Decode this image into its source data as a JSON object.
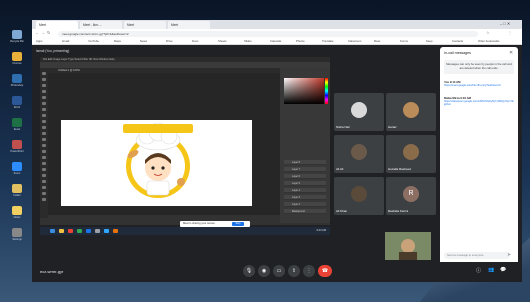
{
  "browser": {
    "tabs": [
      {
        "label": "Meet"
      },
      {
        "label": "Meet - lkm-..."
      },
      {
        "label": "Meet"
      },
      {
        "label": "Meet"
      }
    ],
    "url": "meet.google.com/ecz-wrmr-gyr?pli=1&authuser=2"
  },
  "bookmarks": [
    "Apps",
    "Gmail",
    "YouTube",
    "Maps",
    "News",
    "Drive",
    "Docs",
    "Sheets",
    "Slides",
    "Calendar",
    "Photos",
    "Translate",
    "Classroom",
    "Meet",
    "Forms",
    "Keep",
    "Contacts",
    "Other bookmarks"
  ],
  "presenter": {
    "label": "Ismail (You, presenting)"
  },
  "photoshop": {
    "menu": "File  Edit  Image  Layer  Type  Select  Filter  3D  View  Window  Help",
    "doc_tab": "Untitled-1 @ 100%",
    "layers": [
      "Layer 8",
      "Layer 7",
      "Layer 6",
      "Layer 5",
      "Layer 4",
      "Layer 3",
      "Layer 2",
      "Background"
    ],
    "dialog_text": "Meet is sharing your screen.",
    "dialog_button": "Stop",
    "taskbar_time": "9:23 AM"
  },
  "participants": [
    {
      "name": "Nisha Nair",
      "initial": "",
      "color": "#3c4043"
    },
    {
      "name": "Hariaz",
      "initial": "",
      "color": "#3c4043"
    },
    {
      "name": "Ali Ali",
      "initial": "",
      "color": "#3c4043"
    },
    {
      "name": "Huzaifa Rasheed",
      "initial": "",
      "color": "#3c4043"
    },
    {
      "name": "Ali Khan",
      "initial": "",
      "color": "#3c4043"
    },
    {
      "name": "Rashida Kazmi",
      "initial": "R",
      "color": "#8d6e63"
    }
  ],
  "chat": {
    "title": "In-call messages",
    "notice": "Messages can only be seen by people in the call and are deleted when the call ends.",
    "messages": [
      {
        "sender": "You 9:14 AM",
        "text": "https://meet.google.com/lnk-zlln-mny?authuser=2"
      },
      {
        "sender": "Rabia Mirza 9:16 AM",
        "text": "https://classroom.google.com/c/MzUxNzIyNjYyNDQy?cjc=hhjq3xm"
      }
    ],
    "input_placeholder": "Send a message to everyone"
  },
  "bottom": {
    "meeting_name": "ecz-wrmr-gyr"
  },
  "controls": [
    "mic-icon",
    "camera-icon",
    "caption-icon",
    "present-icon",
    "more-icon",
    "hangup-icon"
  ],
  "desktop_icons": [
    "Recycle Bin",
    "Chrome",
    "Photoshop",
    "Word",
    "Excel",
    "PowerPoint",
    "Zoom",
    "Folder",
    "Notes",
    "Settings"
  ]
}
